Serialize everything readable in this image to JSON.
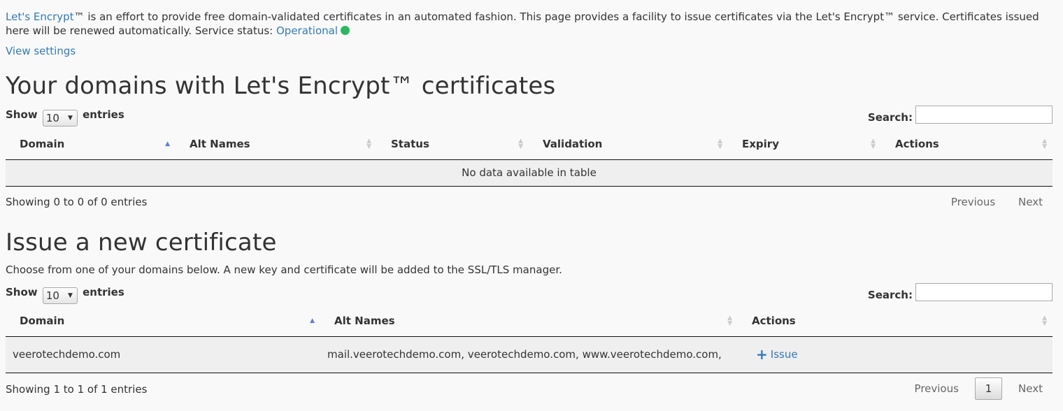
{
  "intro": {
    "link_text": "Let's Encrypt",
    "text1": "™ is an effort to provide free domain-validated certificates in an automated fashion. This page provides a facility to issue certificates via the Let's Encrypt™ service. Certificates issued here will be renewed automatically. Service status: ",
    "status_text": "Operational",
    "status_color": "#2db760"
  },
  "view_settings": "View settings",
  "section1": {
    "title": "Your domains with Let's Encrypt™ certificates",
    "show_label": "Show",
    "length_value": "10",
    "entries_label": "entries",
    "search_label": "Search:",
    "columns": [
      "Domain",
      "Alt Names",
      "Status",
      "Validation",
      "Expiry",
      "Actions"
    ],
    "empty_text": "No data available in table",
    "info": "Showing 0 to 0 of 0 entries",
    "prev": "Previous",
    "next": "Next"
  },
  "section2": {
    "title": "Issue a new certificate",
    "description": "Choose from one of your domains below. A new key and certificate will be added to the SSL/TLS manager.",
    "show_label": "Show",
    "length_value": "10",
    "entries_label": "entries",
    "search_label": "Search:",
    "columns": [
      "Domain",
      "Alt Names",
      "Actions"
    ],
    "rows": [
      {
        "domain": "veerotechdemo.com",
        "alt_names": "mail.veerotechdemo.com, veerotechdemo.com, www.veerotechdemo.com,",
        "action_icon": "+",
        "action": "Issue"
      }
    ],
    "info": "Showing 1 to 1 of 1 entries",
    "prev": "Previous",
    "page": "1",
    "next": "Next"
  }
}
